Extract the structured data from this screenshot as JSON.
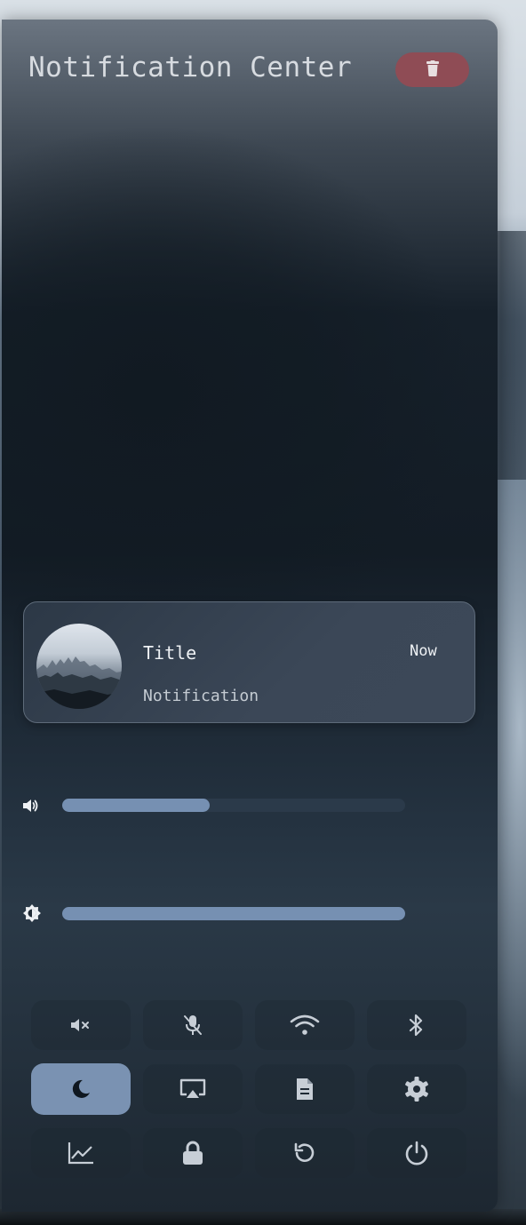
{
  "panel": {
    "title": "Notification Center",
    "clear_button_icon": "trash-icon"
  },
  "notification": {
    "title": "Title",
    "time": "Now",
    "body": "Notification",
    "avatar": "misty-forest-avatar"
  },
  "sliders": {
    "volume": {
      "icon": "volume-icon",
      "level_percent": 43
    },
    "brightness": {
      "icon": "brightness-icon",
      "level_percent": 100
    }
  },
  "quick_toggles": [
    {
      "icon": "mute-speaker-icon",
      "active": false
    },
    {
      "icon": "microphone-muted-icon",
      "active": false
    },
    {
      "icon": "wifi-icon",
      "active": false
    },
    {
      "icon": "bluetooth-icon",
      "active": false
    },
    {
      "icon": "moon-icon",
      "active": true
    },
    {
      "icon": "screen-cast-icon",
      "active": false
    },
    {
      "icon": "document-icon",
      "active": false
    },
    {
      "icon": "gear-icon",
      "active": false
    },
    {
      "icon": "chart-icon",
      "active": false
    },
    {
      "icon": "lock-icon",
      "active": false
    },
    {
      "icon": "refresh-icon",
      "active": false
    },
    {
      "icon": "power-icon",
      "active": false
    }
  ],
  "colors": {
    "accent": "#7a92b2",
    "slider_fill": "#7690b2",
    "clear_button": "#8f4c55"
  }
}
